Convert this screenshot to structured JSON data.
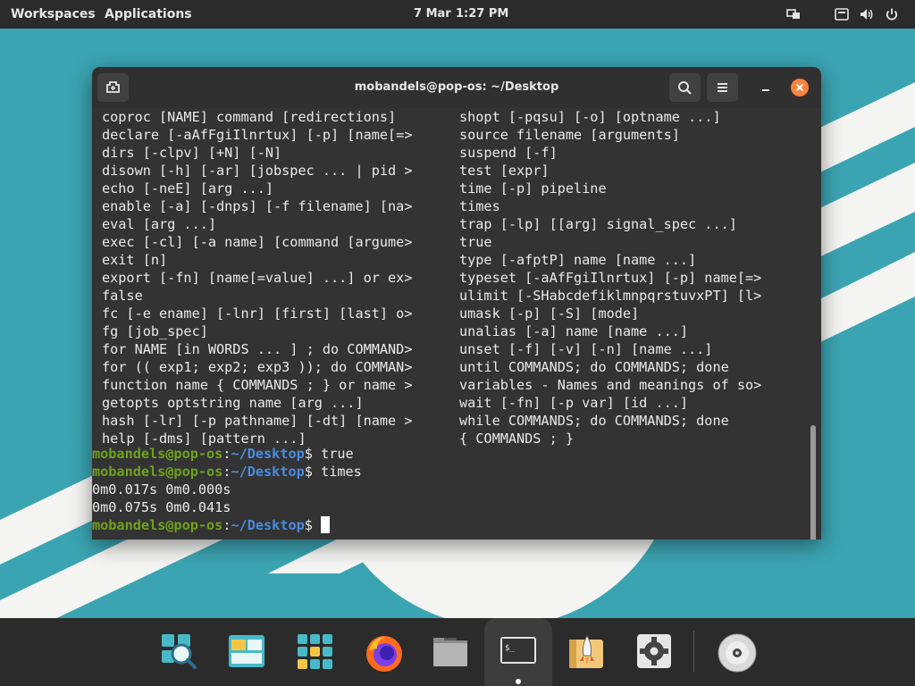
{
  "topbar": {
    "workspaces": "Workspaces",
    "applications": "Applications",
    "date": "7 Mar",
    "time": "1:27 PM",
    "right_icons": [
      "display-icon",
      "keyboard-icon",
      "volume-icon",
      "power-icon"
    ]
  },
  "window": {
    "title": "mobandels@pop-os: ~/Desktop",
    "buttons": [
      "new-tab-icon",
      "search-icon",
      "menu-icon",
      "minimize-icon",
      "close-icon"
    ]
  },
  "terminal": {
    "help_left": [
      "coproc [NAME] command [redirections]",
      "declare [-aAfFgiIlnrtux] [-p] [name[=>",
      "dirs [-clpv] [+N] [-N]",
      "disown [-h] [-ar] [jobspec ... | pid >",
      "echo [-neE] [arg ...]",
      "enable [-a] [-dnps] [-f filename] [na>",
      "eval [arg ...]",
      "exec [-cl] [-a name] [command [argume>",
      "exit [n]",
      "export [-fn] [name[=value] ...] or ex>",
      "false",
      "fc [-e ename] [-lnr] [first] [last] o>",
      "fg [job_spec]",
      "for NAME [in WORDS ... ] ; do COMMAND>",
      "for (( exp1; exp2; exp3 )); do COMMAN>",
      "function name { COMMANDS ; } or name >",
      "getopts optstring name [arg ...]",
      "hash [-lr] [-p pathname] [-dt] [name >",
      "help [-dms] [pattern ...]"
    ],
    "help_right": [
      "shopt [-pqsu] [-o] [optname ...]",
      "source filename [arguments]",
      "suspend [-f]",
      "test [expr]",
      "time [-p] pipeline",
      "times",
      "trap [-lp] [[arg] signal_spec ...]",
      "true",
      "type [-afptP] name [name ...]",
      "typeset [-aAfFgiIlnrtux] [-p] name[=>",
      "ulimit [-SHabcdefiklmnpqrstuvxPT] [l>",
      "umask [-p] [-S] [mode]",
      "unalias [-a] name [name ...]",
      "unset [-f] [-v] [-n] [name ...]",
      "until COMMANDS; do COMMANDS; done",
      "variables - Names and meanings of so>",
      "wait [-fn] [-p var] [id ...]",
      "while COMMANDS; do COMMANDS; done",
      "{ COMMANDS ; }"
    ],
    "prompt_user": "mobandels@pop-os",
    "prompt_colon": ":",
    "prompt_path": "~/Desktop",
    "prompt_symbol": "$ ",
    "cmd1": "true",
    "cmd2": "times",
    "out1": "0m0.017s 0m0.000s",
    "out2": "0m0.075s 0m0.041s",
    "cmd3": ""
  },
  "dock": {
    "items": [
      "launcher-icon",
      "workspaces-icon",
      "app-library-icon",
      "firefox-icon",
      "files-icon",
      "terminal-icon",
      "pop-shop-icon",
      "settings-icon",
      "disc-drive-icon"
    ],
    "active": "terminal-icon"
  },
  "colors": {
    "topbar": "#2b2b2b",
    "window_bg": "#333333",
    "prompt_user": "#6fa21f",
    "prompt_path": "#4a8ce0",
    "close_button": "#fb8239",
    "wallpaper": "#3aa3b1"
  }
}
